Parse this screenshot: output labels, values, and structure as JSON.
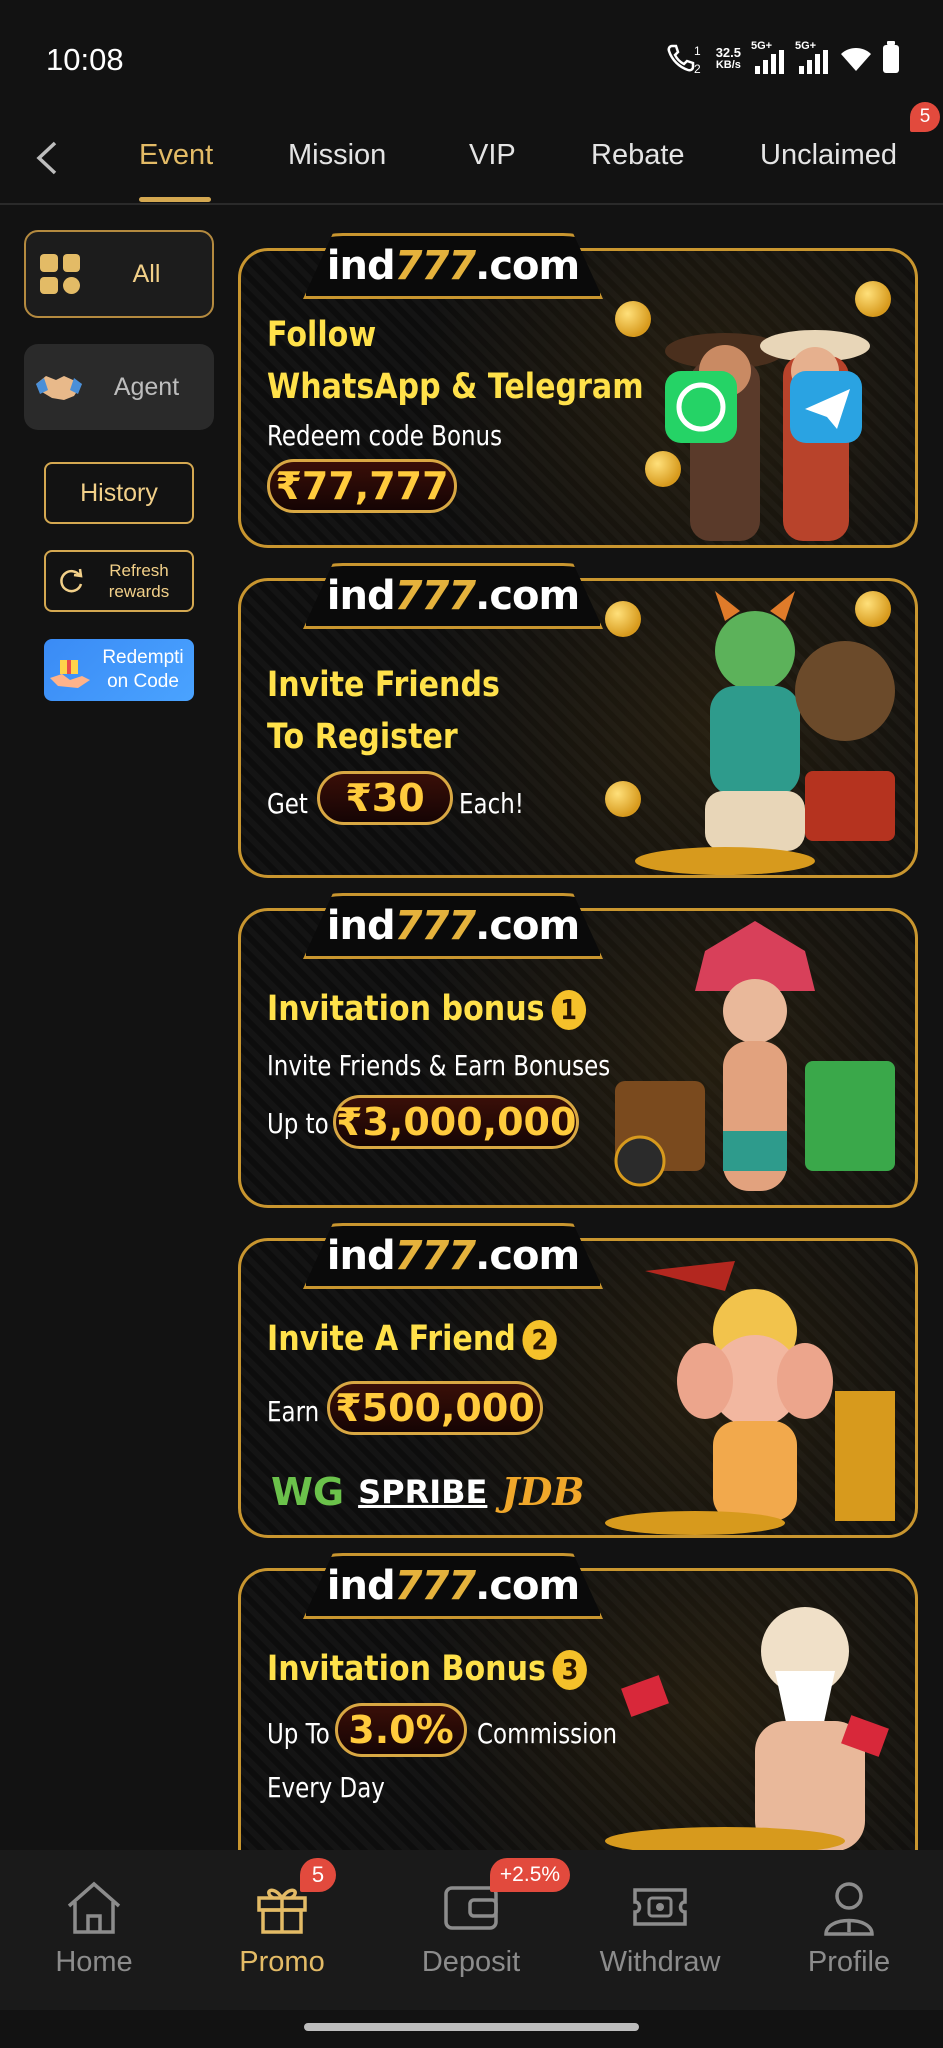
{
  "status_bar": {
    "time": "10:08",
    "net_speed_value": "32.5",
    "net_speed_unit": "KB/s",
    "sim1": "5G+",
    "sim2": "5G+"
  },
  "top_nav": {
    "tabs": [
      {
        "label": "Event",
        "active": true
      },
      {
        "label": "Mission",
        "active": false
      },
      {
        "label": "VIP",
        "active": false
      },
      {
        "label": "Rebate",
        "active": false
      },
      {
        "label": "Unclaimed",
        "active": false,
        "badge": "5"
      }
    ]
  },
  "sidebar": {
    "all_label": "All",
    "agent_label": "Agent",
    "history_label": "History",
    "refresh_label_1": "Refresh",
    "refresh_label_2": "rewards",
    "redeem_label_1": "Redempti",
    "redeem_label_2": "on Code"
  },
  "banners": [
    {
      "logo_a": "ind",
      "logo_b": "777",
      "logo_c": ".com",
      "line1": "Follow",
      "line2": "WhatsApp & Telegram",
      "line3": "Redeem code Bonus",
      "amount": "₹77,777"
    },
    {
      "logo_a": "ind",
      "logo_b": "777",
      "logo_c": ".com",
      "line1": "Invite Friends",
      "line2": "To Register",
      "pre": "Get",
      "amount": "₹30",
      "post": "Each!"
    },
    {
      "logo_a": "ind",
      "logo_b": "777",
      "logo_c": ".com",
      "line1": "Invitation bonus",
      "num": "1",
      "line2": "Invite Friends & Earn Bonuses",
      "pre": "Up to",
      "amount": "₹3,000,000"
    },
    {
      "logo_a": "ind",
      "logo_b": "777",
      "logo_c": ".com",
      "line1": "Invite A Friend",
      "num": "2",
      "pre": "Earn",
      "amount": "₹500,000",
      "brand1": "WG",
      "brand2": "SPRIBE",
      "brand3": "JDB"
    },
    {
      "logo_a": "ind",
      "logo_b": "777",
      "logo_c": ".com",
      "line1": "Invitation Bonus",
      "num": "3",
      "pre": "Up To",
      "amount": "3.0%",
      "post": "Commission",
      "line3": "Every Day"
    }
  ],
  "bottom_nav": {
    "items": [
      {
        "label": "Home",
        "icon": "home-icon"
      },
      {
        "label": "Promo",
        "icon": "gift-icon",
        "active": true,
        "badge": "5"
      },
      {
        "label": "Deposit",
        "icon": "wallet-icon",
        "badge": "+2.5%"
      },
      {
        "label": "Withdraw",
        "icon": "withdraw-icon"
      },
      {
        "label": "Profile",
        "icon": "profile-icon"
      }
    ]
  },
  "colors": {
    "accent_gold": "#e3bb66",
    "background": "#121212",
    "badge_red": "#e24a3d",
    "banner_yellow": "#ffe14a"
  }
}
